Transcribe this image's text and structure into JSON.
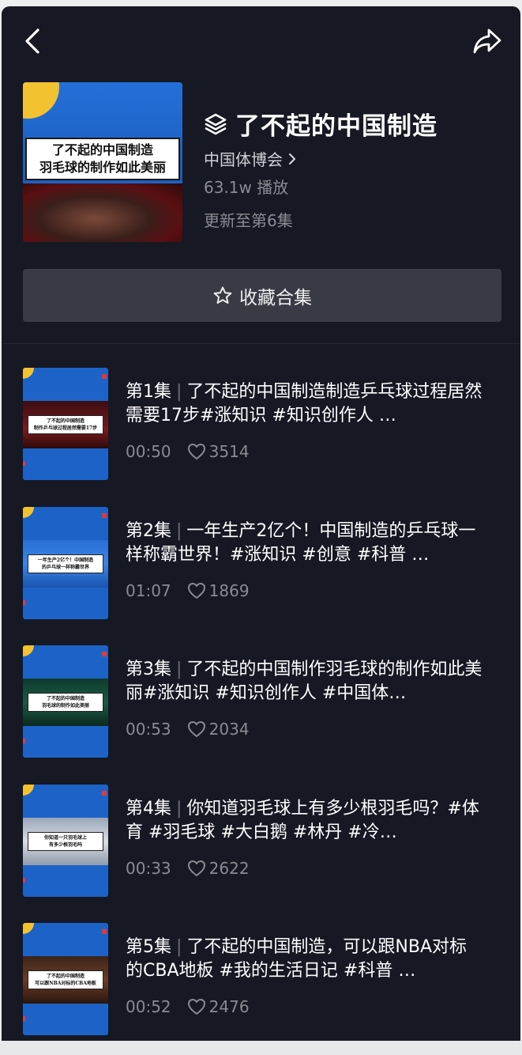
{
  "topbar": {
    "back_icon": "back-arrow-icon",
    "share_icon": "share-arrow-icon"
  },
  "collection": {
    "title": "了不起的中国制造",
    "cover_caption_line1": "了不起的中国制造",
    "cover_caption_line2": "羽毛球的制作如此美丽",
    "author": "中国体博会",
    "plays": "63.1w 播放",
    "updated": "更新至第6集"
  },
  "favorite_button": {
    "label": "收藏合集",
    "icon": "star-icon"
  },
  "episodes": [
    {
      "ep": "第1集",
      "title": "了不起的中国制造制造乒乓球过程居然需要17步#涨知识 #知识创作人 …",
      "duration": "00:50",
      "likes": "3514",
      "thumb_caption_1": "了不起的中国制造",
      "thumb_caption_2": "制作乒乓球过程居然需要17步"
    },
    {
      "ep": "第2集",
      "title": "一年生产2亿个！中国制造的乒乓球一样称霸世界！#涨知识 #创意 #科普 …",
      "duration": "01:07",
      "likes": "1869",
      "thumb_caption_1": "一年生产2亿个！中国制造",
      "thumb_caption_2": "的乒乓球一样称霸世界"
    },
    {
      "ep": "第3集",
      "title": "了不起的中国制作羽毛球的制作如此美丽#涨知识 #知识创作人 #中国体…",
      "duration": "00:53",
      "likes": "2034",
      "thumb_caption_1": "了不起的中国制造",
      "thumb_caption_2": "羽毛球的制作如此美丽"
    },
    {
      "ep": "第4集",
      "title": "你知道羽毛球上有多少根羽毛吗？#体育 #羽毛球 #大白鹅 #林丹 #冷…",
      "duration": "00:33",
      "likes": "2622",
      "thumb_caption_1": "你知道一只羽毛球上",
      "thumb_caption_2": "有多少根羽毛吗"
    },
    {
      "ep": "第5集",
      "title": "了不起的中国制造，可以跟NBA对标的CBA地板 #我的生活日记 #科普 …",
      "duration": "00:52",
      "likes": "2476",
      "thumb_caption_1": "了不起的中国制造",
      "thumb_caption_2": "可以跟NBA对标的CBA地板"
    }
  ],
  "colors": {
    "background": "#161823",
    "button": "#393b44",
    "muted_text": "#8a8b91",
    "thumb_blue": "#1d63c7",
    "accent_yellow": "#f2c230"
  }
}
